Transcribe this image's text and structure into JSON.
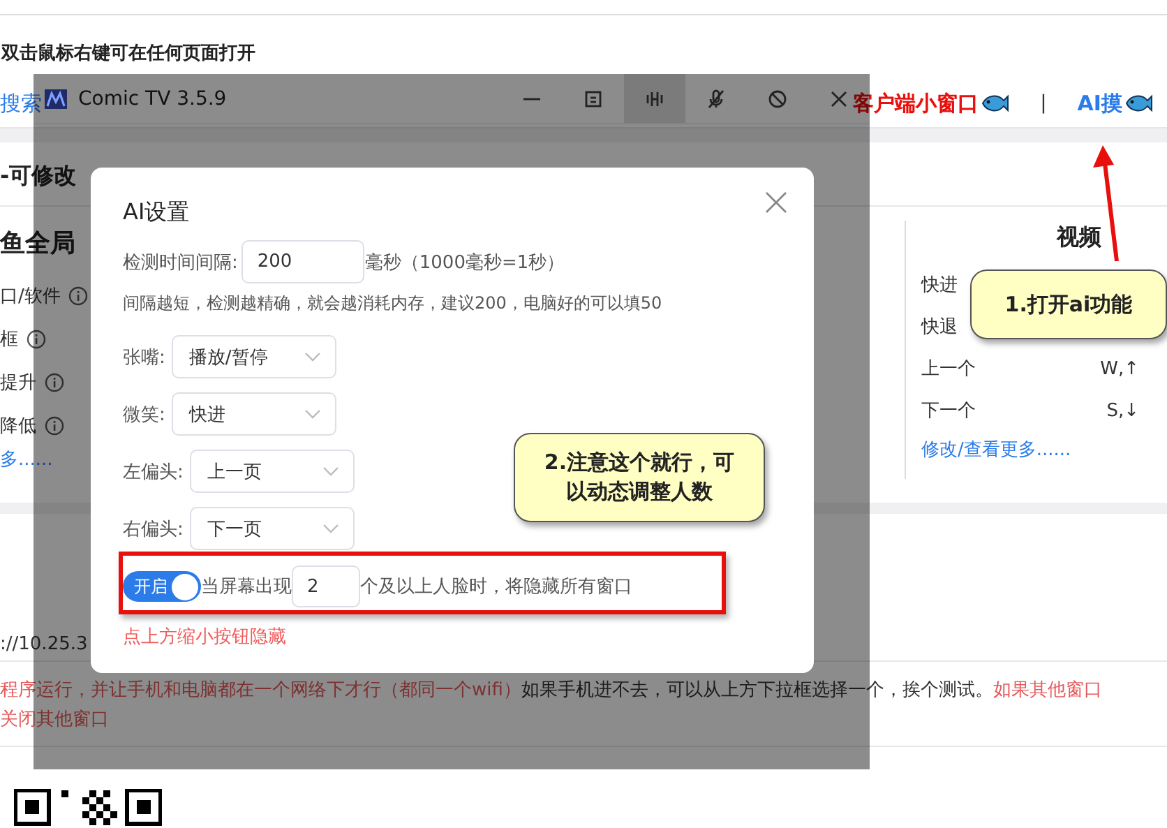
{
  "page": {
    "hint": "双击鼠标右键可在任何页面打开",
    "nav": {
      "search_link": "搜索",
      "client_link": "客户端小窗口",
      "separator": "|",
      "ai_link": "AI摸"
    },
    "section_title": "-可修改",
    "left_panel": {
      "title": "鱼全局",
      "items": [
        "口/软件",
        "框",
        "提升",
        "降低"
      ],
      "more": "多......"
    },
    "video_panel": {
      "title": "视频",
      "shortcuts": [
        {
          "action": "快进"
        },
        {
          "action": "快退"
        },
        {
          "action": "上一个",
          "key": "W,↑"
        },
        {
          "action": "下一个",
          "key": "S,↓"
        }
      ],
      "more": "修改/查看更多......"
    },
    "address": "://10.25.3",
    "notice": [
      {
        "kind": "warning",
        "text": "程序运行，并让手机和电脑都在一个网络下才行（都同一个wifi）"
      },
      {
        "kind": "plain",
        "text": "如果手机进不去，可以从上方下拉框选择一个，挨个测试。"
      },
      {
        "kind": "warning",
        "text": "如果其他窗口"
      }
    ],
    "notice_line_2": "关闭其他窗口"
  },
  "window": {
    "title": "Comic TV 3.5.9",
    "toolbar": [
      {
        "kind": "minimize",
        "selected": false
      },
      {
        "kind": "face",
        "selected": false
      },
      {
        "kind": "wave",
        "selected": true
      },
      {
        "kind": "mic-off",
        "selected": false
      },
      {
        "kind": "ban",
        "selected": false
      },
      {
        "kind": "close",
        "selected": false
      }
    ]
  },
  "dialog": {
    "title": "AI设置",
    "interval": {
      "label": "检测时间间隔:",
      "value": "200",
      "unit": "毫秒（1000毫秒=1秒）"
    },
    "interval_hint": "间隔越短，检测越精确，就会越消耗内存，建议200，电脑好的可以填50",
    "gestures": [
      {
        "label": "张嘴:",
        "value": "播放/暂停"
      },
      {
        "label": "微笑:",
        "value": "快进"
      },
      {
        "label": "左偏头:",
        "value": "上一页"
      },
      {
        "label": "右偏头:",
        "value": "下一页"
      }
    ],
    "face_hide": {
      "toggle_label": "开启",
      "on": true,
      "text_before": "当屏幕出现",
      "count": "2",
      "text_after": "个及以上人脸时，将隐藏所有窗口"
    },
    "hide_hint": "点上方缩小按钮隐藏"
  },
  "annotations": [
    {
      "text": "1.打开ai功能"
    },
    {
      "text": "2.注意这个就行，可以动态调整人数"
    }
  ]
}
